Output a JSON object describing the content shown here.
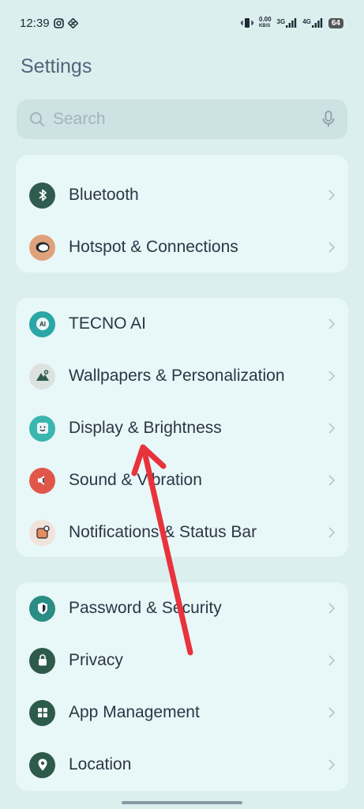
{
  "status_bar": {
    "time": "12:39",
    "net_speed_top": "0.00",
    "net_speed_unit": "KB/S",
    "sim1": "3G",
    "sim2": "4G",
    "battery": "64"
  },
  "header": {
    "title": "Settings"
  },
  "search": {
    "placeholder": "Search"
  },
  "groups": [
    {
      "items": [
        {
          "label": "Bluetooth",
          "icon": "bluetooth-icon",
          "color": "#2f5c4e"
        },
        {
          "label": "Hotspot & Connections",
          "icon": "hotspot-icon",
          "color": "#e0a27a"
        }
      ]
    },
    {
      "items": [
        {
          "label": "TECNO AI",
          "icon": "ai-icon",
          "color": "#2aa6a6"
        },
        {
          "label": "Wallpapers & Personalization",
          "icon": "wallpaper-icon",
          "color": "#dde2df"
        },
        {
          "label": "Display & Brightness",
          "icon": "display-icon",
          "color": "#39b6b0"
        },
        {
          "label": "Sound & Vibration",
          "icon": "sound-icon",
          "color": "#e0574a"
        },
        {
          "label": "Notifications & Status Bar",
          "icon": "notification-icon",
          "color": "#f1e2db"
        }
      ]
    },
    {
      "items": [
        {
          "label": "Password & Security",
          "icon": "shield-icon",
          "color": "#2a8c84"
        },
        {
          "label": "Privacy",
          "icon": "lock-icon",
          "color": "#2e5a4c"
        },
        {
          "label": "App Management",
          "icon": "grid-icon",
          "color": "#2e5a4c"
        },
        {
          "label": "Location",
          "icon": "location-pin-icon",
          "color": "#2e5a4c"
        }
      ]
    }
  ],
  "annotation": {
    "color": "#e8323c"
  }
}
